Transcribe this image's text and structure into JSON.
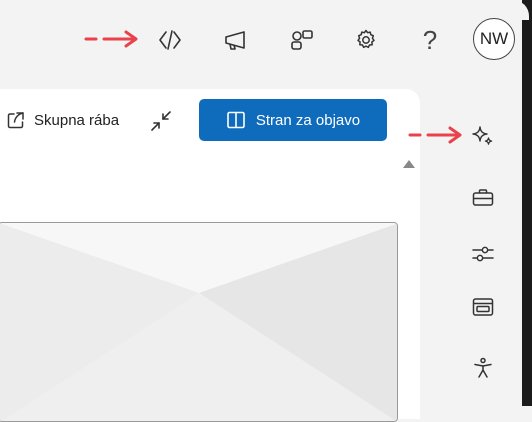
{
  "header": {
    "avatar_initials": "NW",
    "help_label": "?",
    "icons": [
      "embed-code-icon",
      "announcement-icon",
      "apps-icon",
      "settings-icon",
      "help-icon"
    ]
  },
  "toolbar": {
    "share_label": "Skupna rába",
    "publish_label": "Stran za objavo"
  },
  "right_rail": {
    "icons": [
      "copilot-sparkle-icon",
      "briefcase-icon",
      "sliders-icon",
      "layout-icon",
      "accessibility-icon"
    ]
  },
  "colors": {
    "primary": "#0f6cbd",
    "arrow": "#e8434c",
    "background": "#f3f3f3"
  }
}
